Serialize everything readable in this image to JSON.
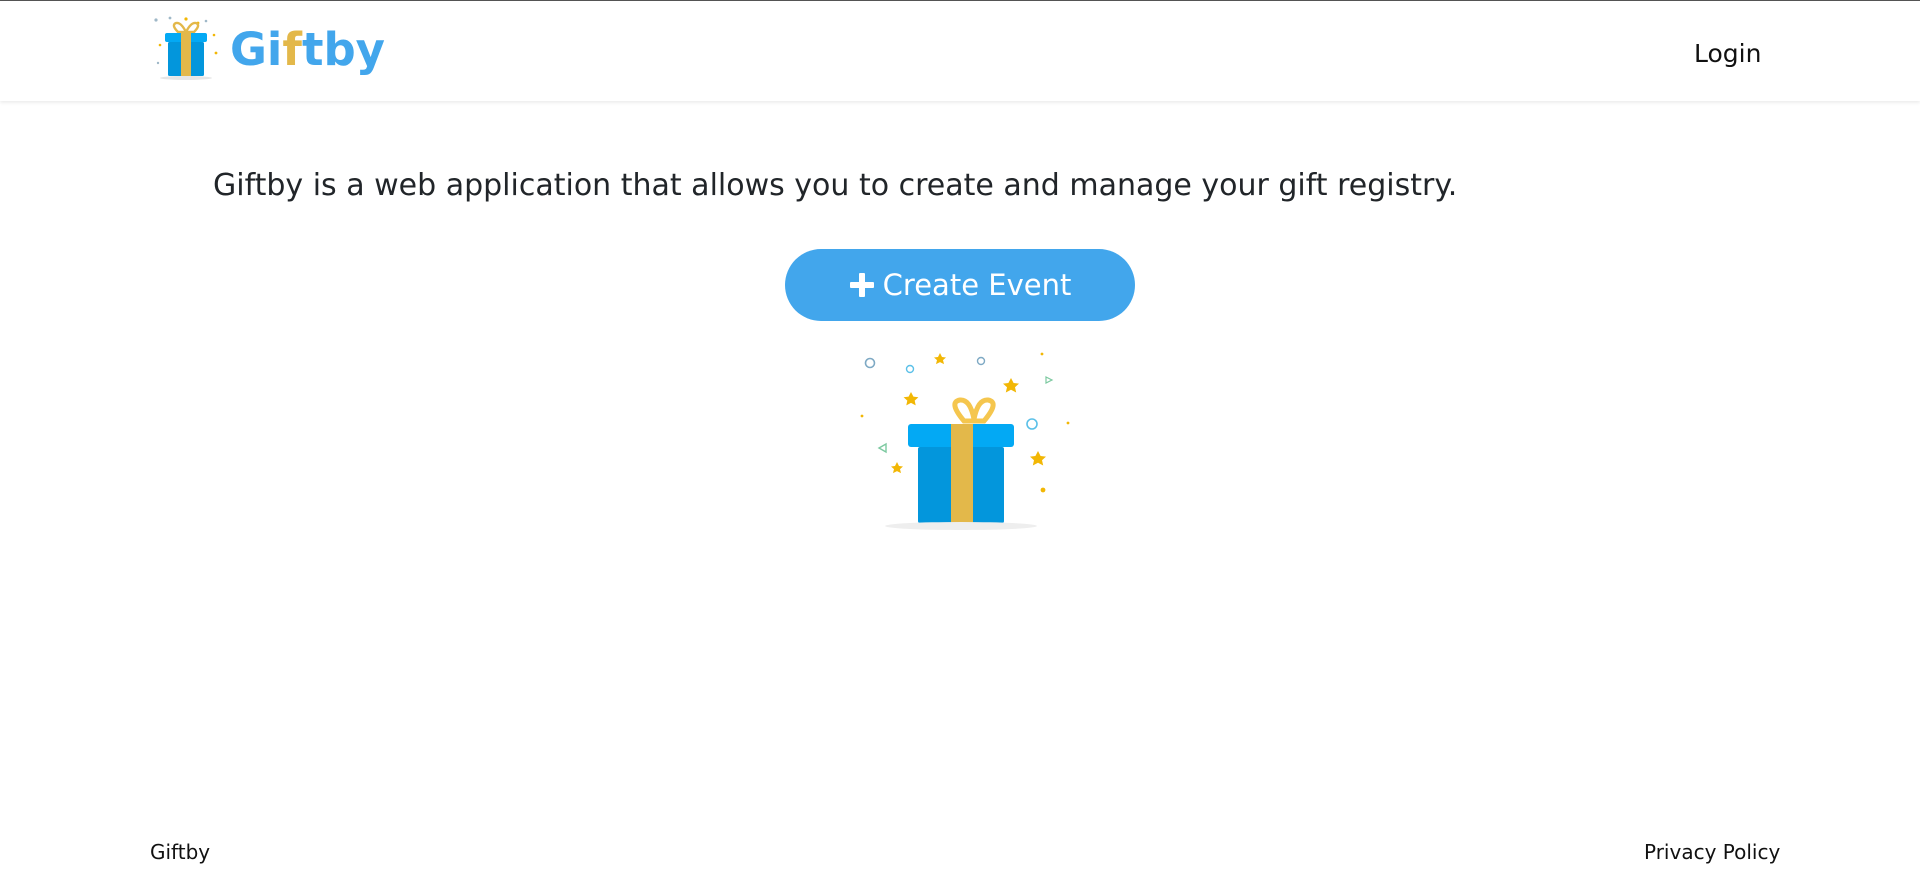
{
  "header": {
    "logo": {
      "text_main": "Gi",
      "text_accent": "f",
      "text_end": "tby",
      "icon": "gift-box-icon"
    },
    "login_label": "Login"
  },
  "main": {
    "intro_text": "Giftby is a web application that allows you to create and manage your gift registry.",
    "create_event_label": "Create Event",
    "create_event_icon": "plus-icon",
    "illustration": "gift-box-illustration"
  },
  "footer": {
    "brand": "Giftby",
    "privacy_label": "Privacy Policy"
  },
  "colors": {
    "brand_blue": "#42a6ec",
    "brand_gold": "#e3b84a",
    "gift_blue": "#0396dc",
    "text": "#212529"
  }
}
